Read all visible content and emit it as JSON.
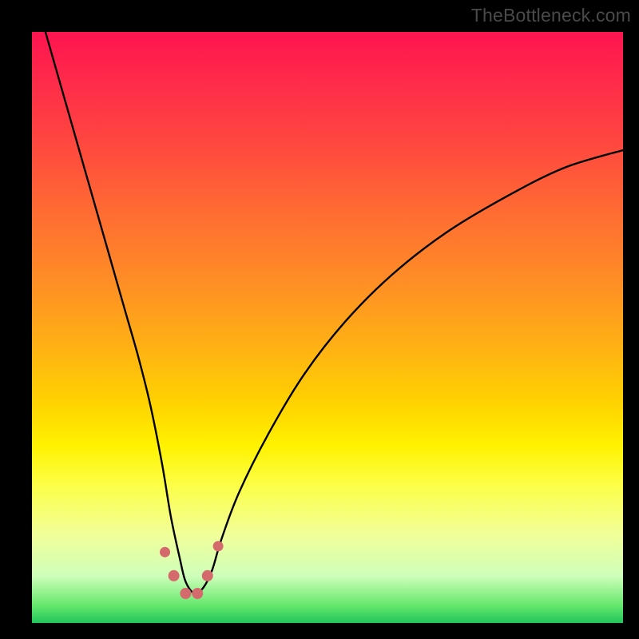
{
  "watermark": "TheBottleneck.com",
  "chart_data": {
    "type": "line",
    "title": "",
    "xlabel": "",
    "ylabel": "",
    "xlim": [
      0,
      100
    ],
    "ylim": [
      0,
      100
    ],
    "series": [
      {
        "name": "bottleneck-curve",
        "x": [
          0,
          2,
          4,
          6,
          8,
          10,
          12,
          14,
          16,
          18,
          20,
          22,
          23.5,
          25,
          26,
          27.5,
          29,
          30.5,
          32,
          35,
          40,
          46,
          53,
          61,
          70,
          80,
          90,
          100
        ],
        "values": [
          108,
          101,
          94,
          87,
          80,
          73,
          66,
          59,
          52,
          45,
          37,
          27,
          18,
          11,
          7,
          5,
          6,
          9,
          14,
          22,
          32,
          42,
          51,
          59,
          66,
          72,
          77,
          80
        ]
      }
    ],
    "markers": [
      {
        "name": "point-a",
        "x": 22.5,
        "y": 12,
        "r": 6.5,
        "color": "#d56a6d"
      },
      {
        "name": "point-b",
        "x": 24.0,
        "y": 8,
        "r": 7.0,
        "color": "#d56a6d"
      },
      {
        "name": "point-c",
        "x": 26.0,
        "y": 5,
        "r": 7.0,
        "color": "#d56a6d"
      },
      {
        "name": "point-d",
        "x": 28.0,
        "y": 5,
        "r": 7.0,
        "color": "#d56a6d"
      },
      {
        "name": "point-e",
        "x": 29.7,
        "y": 8,
        "r": 7.0,
        "color": "#d56a6d"
      },
      {
        "name": "point-f",
        "x": 31.5,
        "y": 13,
        "r": 6.5,
        "color": "#d56a6d"
      }
    ],
    "colors": {
      "curve": "#000000",
      "marker": "#d56a6d",
      "background_top": "#ff1450",
      "background_bottom": "#20c45a",
      "frame": "#000000"
    }
  }
}
